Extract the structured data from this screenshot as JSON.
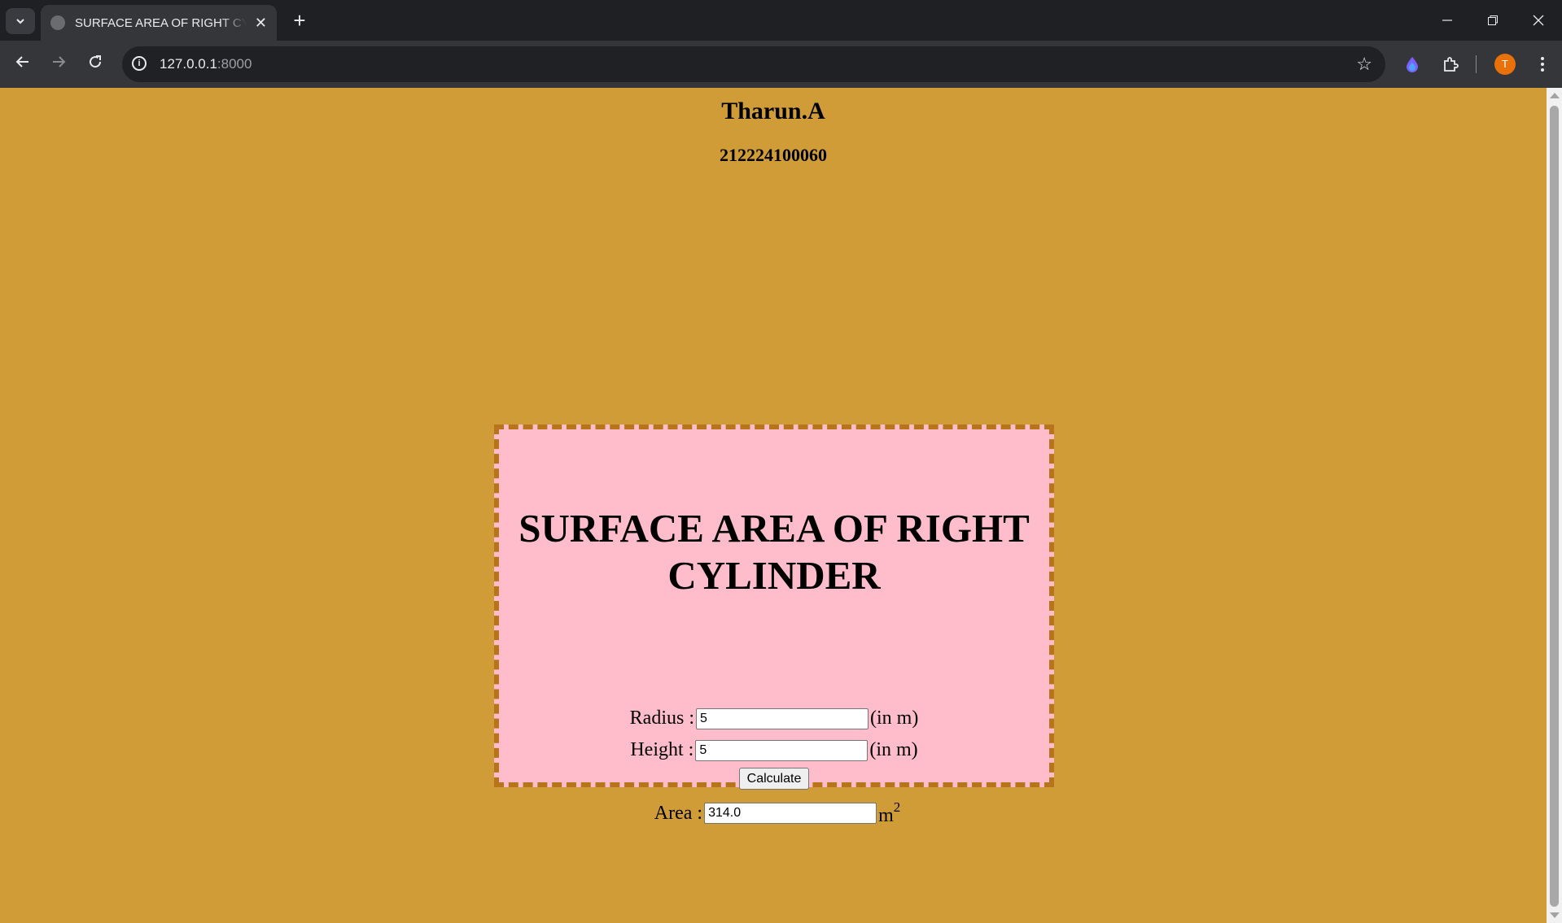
{
  "browser": {
    "tab_title": "SURFACE AREA OF RIGHT CYLINDER",
    "url_host": "127.0.0.1",
    "url_port": ":8000",
    "profile_initial": "T"
  },
  "page": {
    "author_name": "Tharun.A",
    "register_number": "212224100060",
    "heading": "SURFACE AREA OF RIGHT CYLINDER",
    "radius_label": "Radius :",
    "radius_value": "5",
    "radius_unit": "(in m)",
    "height_label": "Height :",
    "height_value": "5",
    "height_unit": "(in m)",
    "calculate_label": "Calculate",
    "area_label": "Area :",
    "area_value": "314.0",
    "area_unit": "m",
    "area_unit_exponent": "2"
  },
  "colors": {
    "page_background": "#d09c38",
    "card_background": "#ffbdcc",
    "card_border": "#b8741a"
  }
}
